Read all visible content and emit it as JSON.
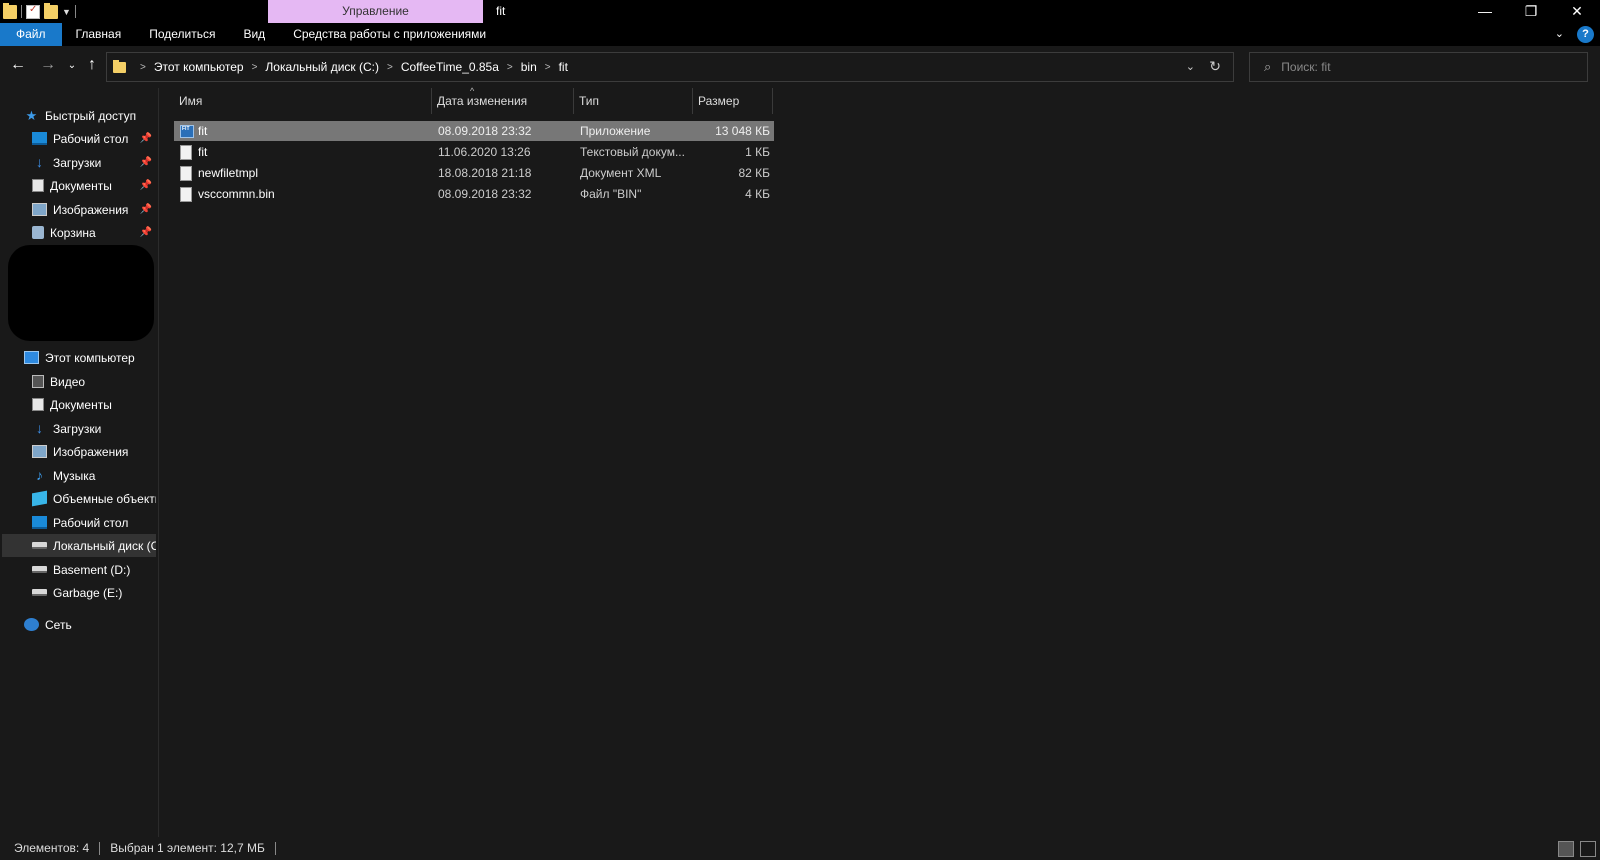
{
  "titlebar": {
    "manage_tab": "Управление",
    "window_title": "fit",
    "min": "—",
    "restore": "❐",
    "close": "✕"
  },
  "ribbon": {
    "tabs": [
      "Файл",
      "Главная",
      "Поделиться",
      "Вид",
      "Средства работы с приложениями"
    ],
    "help": "?"
  },
  "address": {
    "crumbs": [
      "Этот компьютер",
      "Локальный диск (C:)",
      "CoffeeTime_0.85a",
      "bin",
      "fit"
    ]
  },
  "search": {
    "placeholder": "Поиск: fit"
  },
  "nav": {
    "quick_access": "Быстрый доступ",
    "quick_items": [
      "Рабочий стол",
      "Загрузки",
      "Документы",
      "Изображения",
      "Корзина"
    ],
    "this_pc": "Этот компьютер",
    "pc_items": [
      "Видео",
      "Документы",
      "Загрузки",
      "Изображения",
      "Музыка",
      "Объемные объекты",
      "Рабочий стол",
      "Локальный диск (C:)",
      "Basement (D:)",
      "Garbage (E:)"
    ],
    "network": "Сеть"
  },
  "columns": {
    "name": "Имя",
    "date": "Дата изменения",
    "type": "Тип",
    "size": "Размер"
  },
  "files": [
    {
      "name": "fit",
      "date": "08.09.2018 23:32",
      "type": "Приложение",
      "size": "13 048 КБ",
      "icon": "app-icon",
      "selected": true
    },
    {
      "name": "fit",
      "date": "11.06.2020 13:26",
      "type": "Текстовый докум...",
      "size": "1 КБ",
      "icon": "text-file-icon",
      "selected": false
    },
    {
      "name": "newfiletmpl",
      "date": "18.08.2018 21:18",
      "type": "Документ XML",
      "size": "82 КБ",
      "icon": "text-file-icon",
      "selected": false
    },
    {
      "name": "vsccommn.bin",
      "date": "08.09.2018 23:32",
      "type": "Файл \"BIN\"",
      "size": "4 КБ",
      "icon": "text-file-icon",
      "selected": false
    }
  ],
  "status": {
    "count": "Элементов: 4",
    "selected": "Выбран 1 элемент: 12,7 МБ"
  },
  "colors": {
    "accent": "#1979ca",
    "manage_tab": "#e5b8f3",
    "background": "#191919",
    "selection": "#777777"
  }
}
